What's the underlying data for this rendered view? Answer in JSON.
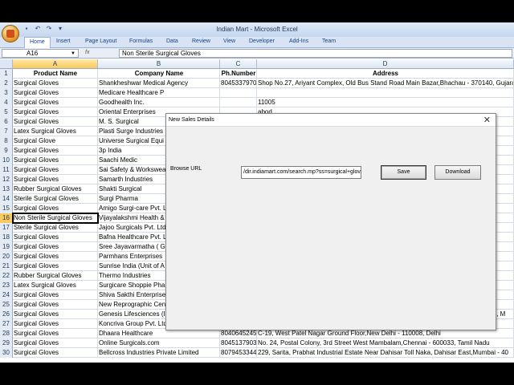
{
  "window": {
    "title": "Indian Mart - Microsoft Excel"
  },
  "ribbon": {
    "tabs": [
      "Home",
      "Insert",
      "Page Layout",
      "Formulas",
      "Data",
      "Review",
      "View",
      "Developer",
      "Add-Ins",
      "Team"
    ]
  },
  "formula_bar": {
    "name_box": "A16",
    "fx": "fx",
    "content": "Non Sterile Surgical Gloves"
  },
  "columns": [
    "A",
    "B",
    "C",
    "D"
  ],
  "rows": [
    {
      "n": "1",
      "a": "Product Name",
      "b": "Company Name",
      "c": "Ph.Number",
      "d": "Address"
    },
    {
      "n": "2",
      "a": "Surgical Gloves",
      "b": "Shankheshwar Medical Agency",
      "c": "8045337970",
      "d": "Shop No.27, Ariyant Complex, Old Bus Stand Road Main Bazar,Bhachau - 370140, Gujarat"
    },
    {
      "n": "3",
      "a": "Surgical Gloves",
      "b": "Medicare Healthcare P",
      "c": "",
      "d": ""
    },
    {
      "n": "4",
      "a": "Surgical Gloves",
      "b": "Goodhealth Inc.",
      "c": "",
      "d": "11005"
    },
    {
      "n": "5",
      "a": "Surgical Gloves",
      "b": "Oriental Enterprises",
      "c": "",
      "d": "abod"
    },
    {
      "n": "6",
      "a": "Surgical Gloves",
      "b": "M. S. Surgical",
      "c": "",
      "d": "ujarat"
    },
    {
      "n": "7",
      "a": "Latex Surgical Gloves",
      "b": "Plasti Surge Industries",
      "c": "",
      "d": ""
    },
    {
      "n": "8",
      "a": "Surgical Glove",
      "b": "Universe Surgical Equi",
      "c": "",
      "d": "ple,Ch"
    },
    {
      "n": "9",
      "a": "Surgical Gloves",
      "b": "3p India",
      "c": "",
      "d": ""
    },
    {
      "n": "10",
      "a": "Surgical Gloves",
      "b": "Saachi Medic",
      "c": "",
      "d": "0072"
    },
    {
      "n": "11",
      "a": "Surgical Gloves",
      "b": "Sai Safety & Workswea",
      "c": "",
      "d": ""
    },
    {
      "n": "12",
      "a": "Surgical Gloves",
      "b": "Samarth Industries",
      "c": "",
      "d": ""
    },
    {
      "n": "13",
      "a": "Rubber Surgical Gloves",
      "b": "Shakti Surgical",
      "c": "",
      "d": "est,M"
    },
    {
      "n": "14",
      "a": "Sterile Surgical Gloves",
      "b": "Surgi Pharma",
      "c": "",
      "d": "ast,M"
    },
    {
      "n": "15",
      "a": "Surgical Gloves",
      "b": "Amigo Surgi-care Pvt. L",
      "c": "",
      "d": ""
    },
    {
      "n": "16",
      "a": "Non Sterile Surgical Gloves",
      "b": "Vijayalakshmi Health &",
      "c": "",
      "d": "Prak,C"
    },
    {
      "n": "17",
      "a": "Sterile Surgical Gloves",
      "b": "Jajoo Surgicals Pvt. Ltd",
      "c": "",
      "d": "45201"
    },
    {
      "n": "18",
      "a": "Surgical Gloves",
      "b": "Bafna Healthcare Pvt. L",
      "c": "",
      "d": ""
    },
    {
      "n": "19",
      "a": "Surgical Gloves",
      "b": "Sree Jayavarmatha ( GI",
      "c": "",
      "d": "- 600"
    },
    {
      "n": "20",
      "a": "Surgical Gloves",
      "b": "Parmhans Enterprises",
      "c": "",
      "d": ""
    },
    {
      "n": "21",
      "a": "Surgical Gloves",
      "b": "Sunrise India (Unit of A",
      "c": "",
      "d": "ensi"
    },
    {
      "n": "22",
      "a": "Rubber Surgical Gloves",
      "b": "Thermo Industries",
      "c": "",
      "d": ""
    },
    {
      "n": "23",
      "a": "Latex Surgical Gloves",
      "b": "Surgicare Shoppie Pha",
      "c": "",
      "d": "derat"
    },
    {
      "n": "24",
      "a": "Surgical Gloves",
      "b": "Shiva Sakthi Enterprise",
      "c": "",
      "d": "essor,"
    },
    {
      "n": "25",
      "a": "Surgical Gloves",
      "b": "New Reprographic Centre",
      "c": "8079443323",
      "d": "77, Netaji Subhash Road, Ground Floor,Kolkata - 700001, West Bengal"
    },
    {
      "n": "26",
      "a": "Surgical Gloves",
      "b": "Genesis Lifesciences (India) Private Limi",
      "c": "8042901418",
      "d": "Guru Dakshina Complex, Wagholi, Ground Floor, Near Mapple Hotel,Pune - 412207, M"
    },
    {
      "n": "27",
      "a": "Surgical Gloves",
      "b": "Koncriva Group Pvt. Ltd.",
      "c": "8048619261",
      "d": "No. 39/1414, Aravindakshan Lane Kaloor,Ernakulam - 682028, Kerala"
    },
    {
      "n": "28",
      "a": "Surgical Gloves",
      "b": "Dhaara Healthcare",
      "c": "8040645245",
      "d": "C-19, West Patel Nagar Ground Floor,New Delhi - 110008, Delhi"
    },
    {
      "n": "29",
      "a": "Surgical Gloves",
      "b": "Online Surgicals.com",
      "c": "8045137903",
      "d": "No. 24, Postal Colony, 3rd Street West Mambalam,Chennai - 600033, Tamil Nadu"
    },
    {
      "n": "30",
      "a": "Surgical Gloves",
      "b": "Bellcross Industries Private Limited",
      "c": "8079453344",
      "d": "229, Sarita, Prabhat Industrial Estate Near Dahisar Toll Naka, Dahisar East,Mumbai - 40"
    }
  ],
  "dialog": {
    "title": "New Sales Details",
    "close": "✕",
    "label": "Browse URL",
    "url_value": "/dir.indiamart.com/search.mp?ss=surgical+gloves",
    "save": "Save",
    "download": "Download"
  }
}
